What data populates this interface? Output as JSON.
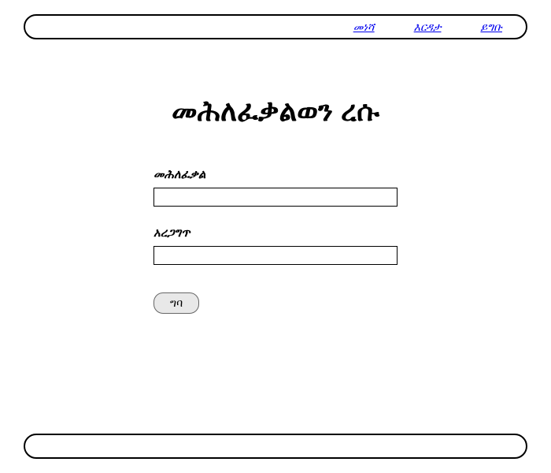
{
  "nav": {
    "links": [
      {
        "label": "መነሻ"
      },
      {
        "label": "እርዳታ"
      },
      {
        "label": "ይግቡ"
      }
    ]
  },
  "page": {
    "title": "መሕለፈቃልወን ረሱ"
  },
  "form": {
    "password_label": "መሕለፈቃል",
    "confirm_label": "አረጋግጥ",
    "submit_label": "ግባ"
  }
}
